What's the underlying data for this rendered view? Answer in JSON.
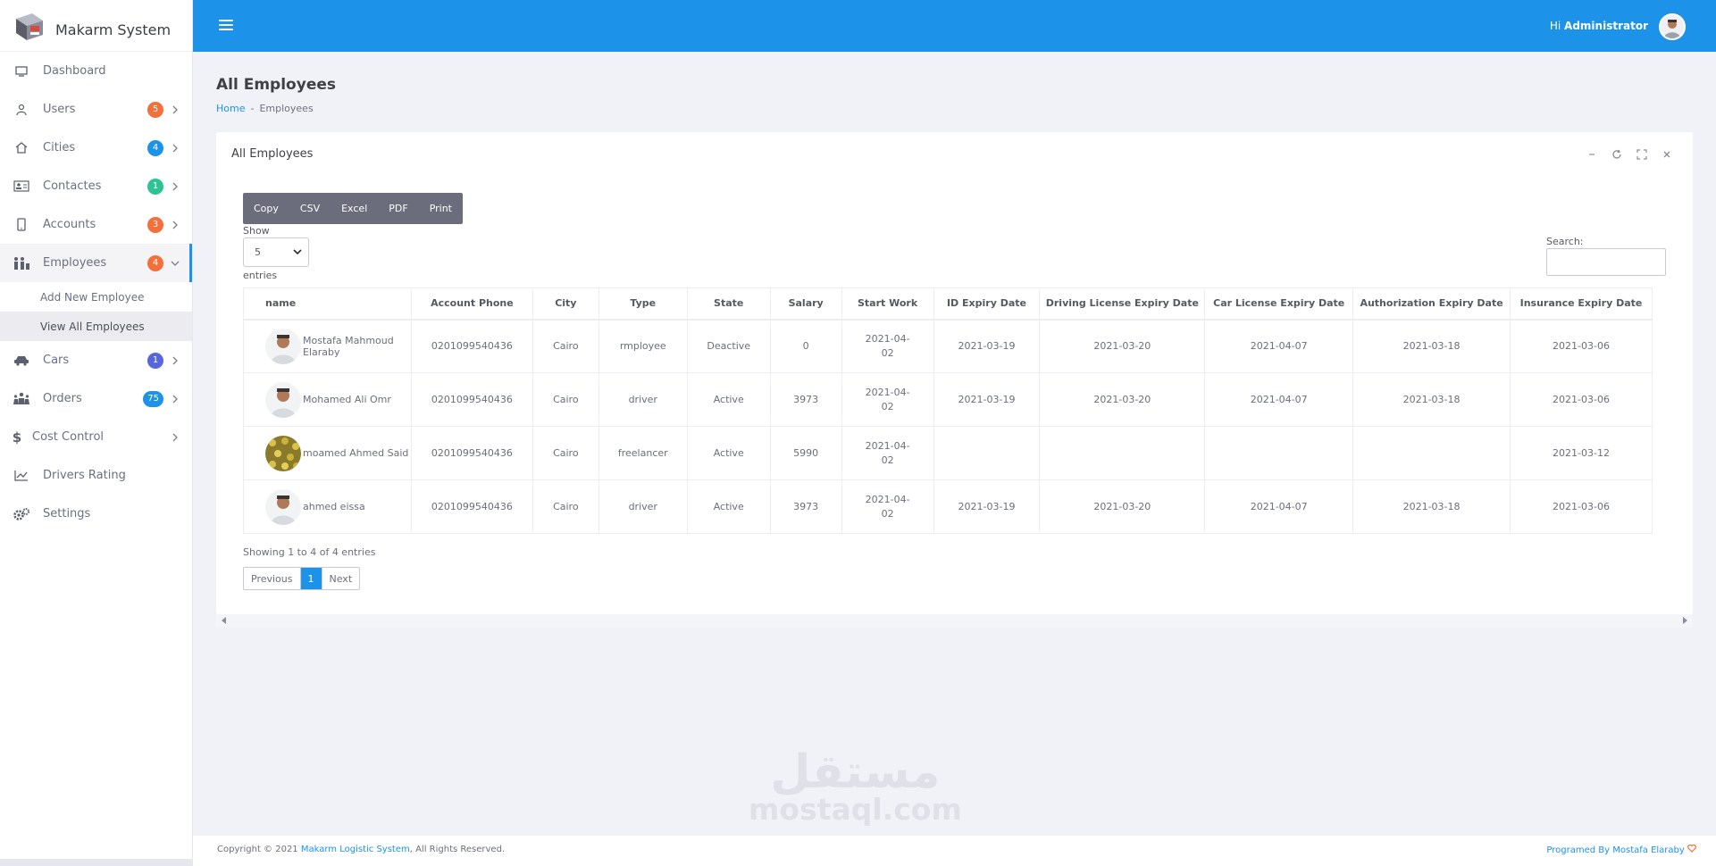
{
  "app": {
    "brand": "Makarm System"
  },
  "topbar": {
    "greeting_prefix": "Hi",
    "user_name": "Administrator"
  },
  "sidebar": {
    "items": [
      {
        "label": "Dashboard",
        "icon": "monitor-icon",
        "badge": null
      },
      {
        "label": "Users",
        "icon": "users-icon",
        "badge": "5",
        "badge_color": "#f4703b",
        "chevron": "right"
      },
      {
        "label": "Cities",
        "icon": "home-icon",
        "badge": "4",
        "badge_color": "#1c92e8",
        "chevron": "right"
      },
      {
        "label": "Contactes",
        "icon": "contact-card-icon",
        "badge": "1",
        "badge_color": "#2ec392",
        "chevron": "right"
      },
      {
        "label": "Accounts",
        "icon": "mobile-icon",
        "badge": "3",
        "badge_color": "#f4703b",
        "chevron": "right"
      },
      {
        "label": "Employees",
        "icon": "employees-icon",
        "badge": "4",
        "badge_color": "#f4703b",
        "chevron": "down"
      },
      {
        "label": "Cars",
        "icon": "car-icon",
        "badge": "1",
        "badge_color": "#5866dd",
        "chevron": "right"
      },
      {
        "label": "Orders",
        "icon": "people-group-icon",
        "badge": "75",
        "badge_color": "#1c92e8",
        "chevron": "right"
      },
      {
        "label": "Cost Control",
        "icon": "dollar-icon",
        "badge": null,
        "chevron": "right"
      },
      {
        "label": "Drivers Rating",
        "icon": "line-chart-icon",
        "badge": null
      },
      {
        "label": "Settings",
        "icon": "gears-icon",
        "badge": null
      }
    ],
    "employees_sub": [
      {
        "label": "Add New Employee"
      },
      {
        "label": "View All Employees"
      }
    ]
  },
  "page": {
    "title": "All Employees",
    "breadcrumb_home": "Home",
    "breadcrumb_sep": "-",
    "breadcrumb_current": "Employees"
  },
  "card": {
    "title": "All Employees",
    "export_buttons": [
      "Copy",
      "CSV",
      "Excel",
      "PDF",
      "Print"
    ],
    "show_label": "Show",
    "show_value": "5",
    "entries_label": "entries",
    "search_label": "Search:",
    "search_value": ""
  },
  "table": {
    "columns": [
      "name",
      "Account Phone",
      "City",
      "Type",
      "State",
      "Salary",
      "Start Work",
      "ID Expiry Date",
      "Driving License Expiry Date",
      "Car License Expiry Date",
      "Authorization Expiry Date",
      "Insurance Expiry Date"
    ],
    "rows": [
      {
        "name": "Mostafa Mahmoud Elaraby",
        "phone": "0201099540436",
        "city": "Cairo",
        "type": "rmployee",
        "state": "Deactive",
        "salary": "0",
        "start_a": "2021-04-",
        "start_b": "02",
        "id_exp": "2021-03-19",
        "dl_exp": "2021-03-20",
        "cl_exp": "2021-04-07",
        "auth_exp": "2021-03-18",
        "ins_exp": "2021-03-06",
        "avatar": "person-photo"
      },
      {
        "name": "Mohamed Ali Omr",
        "phone": "0201099540436",
        "city": "Cairo",
        "type": "driver",
        "state": "Active",
        "salary": "3973",
        "start_a": "2021-04-",
        "start_b": "02",
        "id_exp": "2021-03-19",
        "dl_exp": "2021-03-20",
        "cl_exp": "2021-04-07",
        "auth_exp": "2021-03-18",
        "ins_exp": "2021-03-06",
        "avatar": "person-photo"
      },
      {
        "name": "moamed Ahmed Said",
        "phone": "0201099540436",
        "city": "Cairo",
        "type": "freelancer",
        "state": "Active",
        "salary": "5990",
        "start_a": "2021-04-",
        "start_b": "02",
        "id_exp": "",
        "dl_exp": "",
        "cl_exp": "",
        "auth_exp": "",
        "ins_exp": "2021-03-12",
        "avatar": "pattern-photo"
      },
      {
        "name": "ahmed eissa",
        "phone": "0201099540436",
        "city": "Cairo",
        "type": "driver",
        "state": "Active",
        "salary": "3973",
        "start_a": "2021-04-",
        "start_b": "02",
        "id_exp": "2021-03-19",
        "dl_exp": "2021-03-20",
        "cl_exp": "2021-04-07",
        "auth_exp": "2021-03-18",
        "ins_exp": "2021-03-06",
        "avatar": "person-photo"
      }
    ],
    "showing": "Showing 1 to 4 of 4 entries",
    "pager": {
      "prev": "Previous",
      "current": "1",
      "next": "Next"
    }
  },
  "watermark": {
    "arabic": "مستقل",
    "latin": "mostaql.com"
  },
  "footer": {
    "copyright_prefix": "Copyright © 2021",
    "company_link": "Makarm Logistic System",
    "copyright_suffix": ", All Rights Reserved.",
    "credit": "Programed By Mostafa Elaraby"
  },
  "colors": {
    "primary": "#1c92e8",
    "orange": "#f4703b",
    "green": "#2ec392",
    "indigo": "#5866dd",
    "button_dark": "#6b6d7c"
  }
}
